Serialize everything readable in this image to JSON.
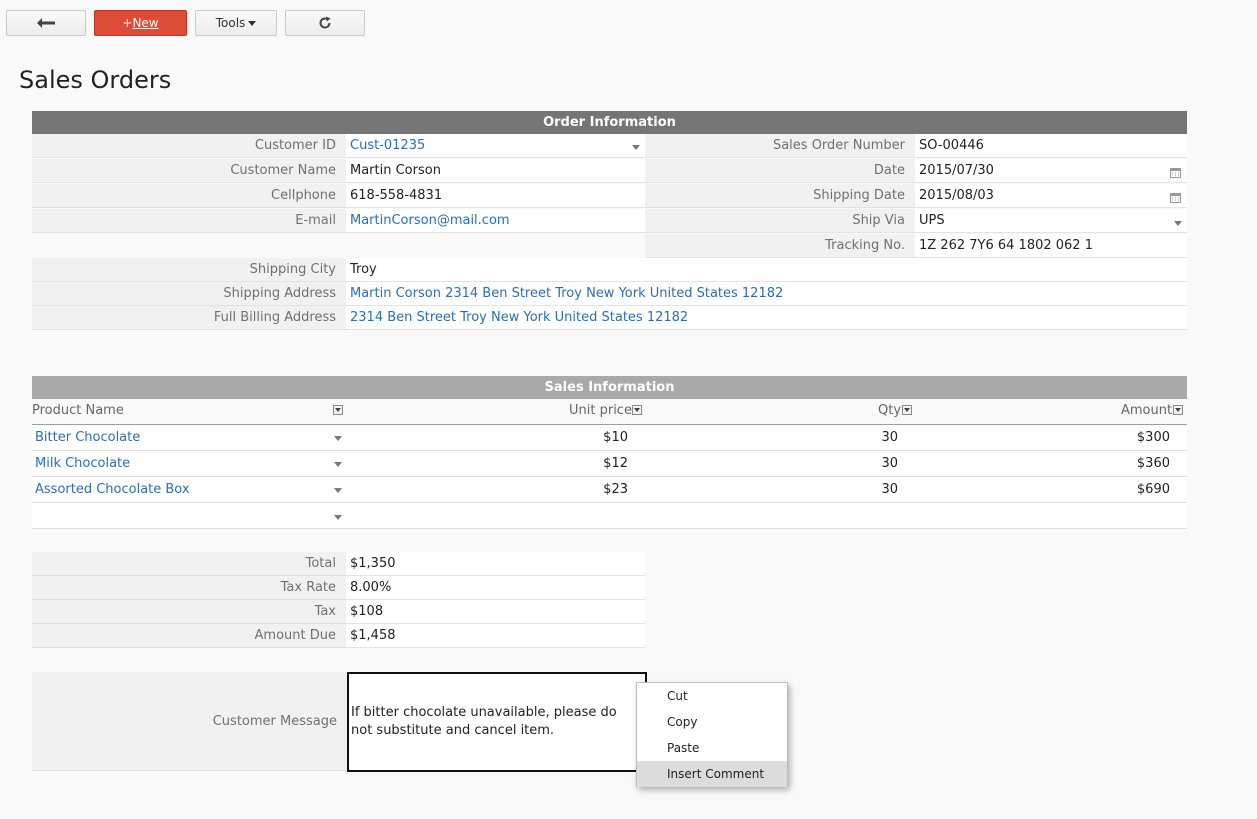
{
  "toolbar": {
    "back_icon": "arrow-left-icon",
    "new_prefix": "+",
    "new_label": "New",
    "tools_label": "Tools",
    "refresh_icon": "refresh-icon"
  },
  "page_title": "Sales Orders",
  "order_info": {
    "header": "Order Information",
    "customer_id_label": "Customer ID",
    "customer_id": "Cust-01235",
    "customer_name_label": "Customer Name",
    "customer_name": "Martin Corson",
    "cellphone_label": "Cellphone",
    "cellphone": "618-558-4831",
    "email_label": "E-mail",
    "email": "MartinCorson@mail.com",
    "so_number_label": "Sales Order Number",
    "so_number": "SO-00446",
    "date_label": "Date",
    "date": "2015/07/30",
    "shipping_date_label": "Shipping Date",
    "shipping_date": "2015/08/03",
    "ship_via_label": "Ship Via",
    "ship_via": "UPS",
    "tracking_label": "Tracking No.",
    "tracking": "1Z 262 7Y6 64 1802 062 1",
    "shipping_city_label": "Shipping City",
    "shipping_city": "Troy",
    "shipping_address_label": "Shipping Address",
    "shipping_address": "Martin Corson 2314 Ben Street Troy New York United States 12182",
    "billing_address_label": "Full Billing Address",
    "billing_address": "2314 Ben Street Troy New York United States 12182"
  },
  "sales_info": {
    "header": "Sales Information",
    "columns": [
      "Product Name",
      "Unit price",
      "Qty",
      "Amount"
    ],
    "rows": [
      {
        "product": "Bitter Chocolate",
        "unit_price": "$10",
        "qty": "30",
        "amount": "$300"
      },
      {
        "product": "Milk Chocolate",
        "unit_price": "$12",
        "qty": "30",
        "amount": "$360"
      },
      {
        "product": "Assorted Chocolate Box",
        "unit_price": "$23",
        "qty": "30",
        "amount": "$690"
      },
      {
        "product": "",
        "unit_price": "",
        "qty": "",
        "amount": ""
      }
    ]
  },
  "totals": {
    "total_label": "Total",
    "total": "$1,350",
    "tax_rate_label": "Tax Rate",
    "tax_rate": "8.00%",
    "tax_label": "Tax",
    "tax": "$108",
    "amount_due_label": "Amount Due",
    "amount_due": "$1,458"
  },
  "customer_message": {
    "label": "Customer Message",
    "text": "If bitter chocolate unavailable, please do not substitute and cancel item."
  },
  "context_menu": {
    "items": [
      "Cut",
      "Copy",
      "Paste",
      "Insert Comment"
    ],
    "highlighted": "Insert Comment"
  },
  "colors": {
    "new_button": "#dd4b39",
    "order_header": "#757575",
    "sales_header": "#a9a9a9",
    "link": "#2a6fb5"
  }
}
